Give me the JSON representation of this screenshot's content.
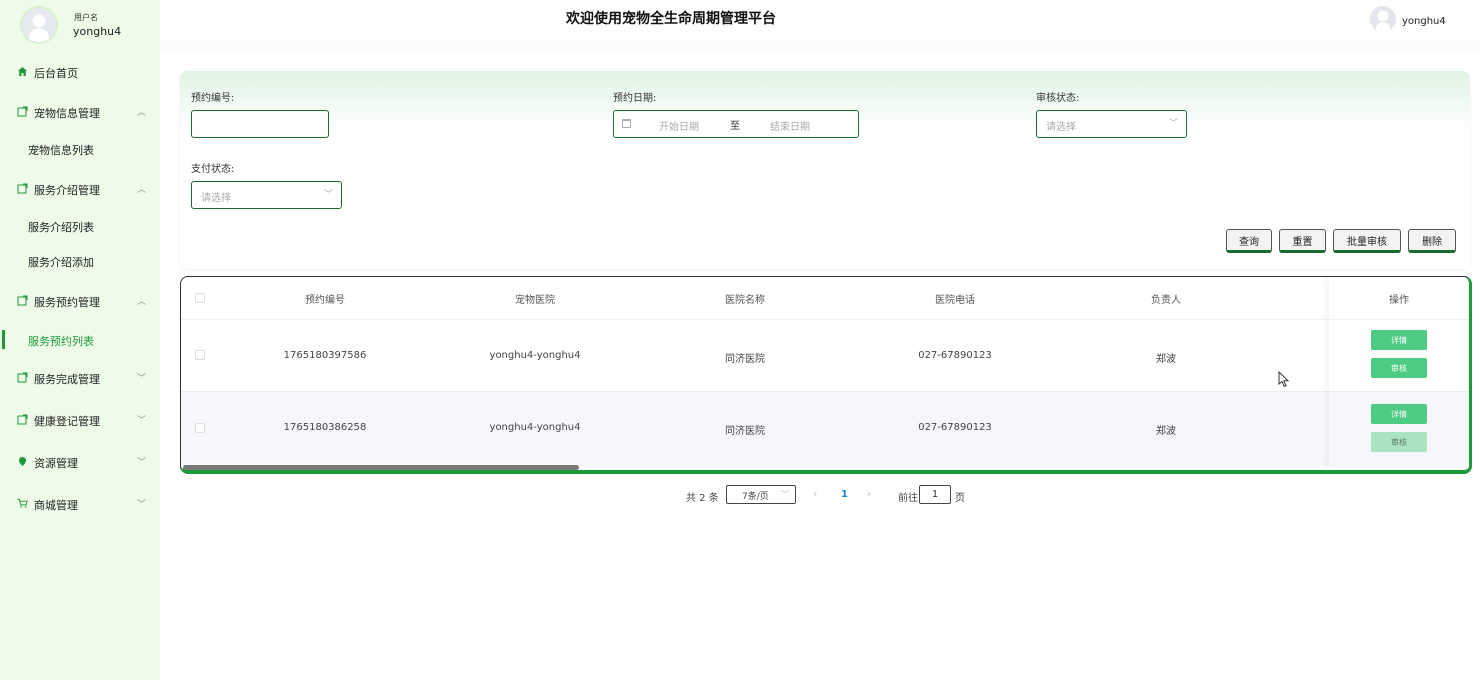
{
  "sidebar": {
    "user_label": "用户名",
    "user_name": "yonghu4",
    "items": [
      {
        "label": "后台首页",
        "icon": "home-icon"
      },
      {
        "label": "宠物信息管理",
        "icon": "folder-icon",
        "arrow": "^"
      },
      {
        "label": "宠物信息列表"
      },
      {
        "label": "服务介绍管理",
        "icon": "folder-icon",
        "arrow": "^"
      },
      {
        "label": "服务介绍列表"
      },
      {
        "label": "服务介绍添加"
      },
      {
        "label": "服务预约管理",
        "icon": "folder-icon",
        "arrow": "^"
      },
      {
        "label": "服务预约列表"
      },
      {
        "label": "服务完成管理",
        "icon": "folder-icon",
        "arrow": "v"
      },
      {
        "label": "健康登记管理",
        "icon": "folder-icon",
        "arrow": "v"
      },
      {
        "label": "资源管理",
        "icon": "location-icon",
        "arrow": "v"
      },
      {
        "label": "商城管理",
        "icon": "cart-icon",
        "arrow": "v"
      }
    ]
  },
  "header": {
    "title": "欢迎使用宠物全生命周期管理平台",
    "user": "yonghu4"
  },
  "search": {
    "booking_no_label": "预约编号:",
    "booking_no_value": "",
    "date_label": "预约日期:",
    "date_start_placeholder": "开始日期",
    "date_separator": "至",
    "date_end_placeholder": "结束日期",
    "audit_label": "审核状态:",
    "audit_placeholder": "请选择",
    "pay_label": "支付状态:",
    "pay_placeholder": "请选择"
  },
  "actions": {
    "query": "查询",
    "reset": "重置",
    "batch_audit": "批量审核",
    "delete": "删除"
  },
  "table": {
    "headers": [
      "预约编号",
      "宠物医院",
      "医院名称",
      "医院电话",
      "负责人",
      "操作"
    ],
    "rows": [
      {
        "booking_no": "1765180397586",
        "hospital": "yonghu4-yonghu4",
        "hospital_name": "同济医院",
        "phone": "027-67890123",
        "owner": "郑波",
        "detail": "详情",
        "audit": "审核"
      },
      {
        "booking_no": "1765180386258",
        "hospital": "yonghu4-yonghu4",
        "hospital_name": "同济医院",
        "phone": "027-67890123",
        "owner": "郑波",
        "detail": "详情",
        "audit": "审核"
      }
    ]
  },
  "pagination": {
    "total": "共 2 条",
    "page_size": "7条/页",
    "current_page": "1",
    "goto_label": "前往",
    "goto_value": "1",
    "page_suffix": "页"
  },
  "colors": {
    "sidebar_bg": "#eefbe9",
    "accent": "#1e9a3a",
    "op_button": "#4ecb84"
  }
}
